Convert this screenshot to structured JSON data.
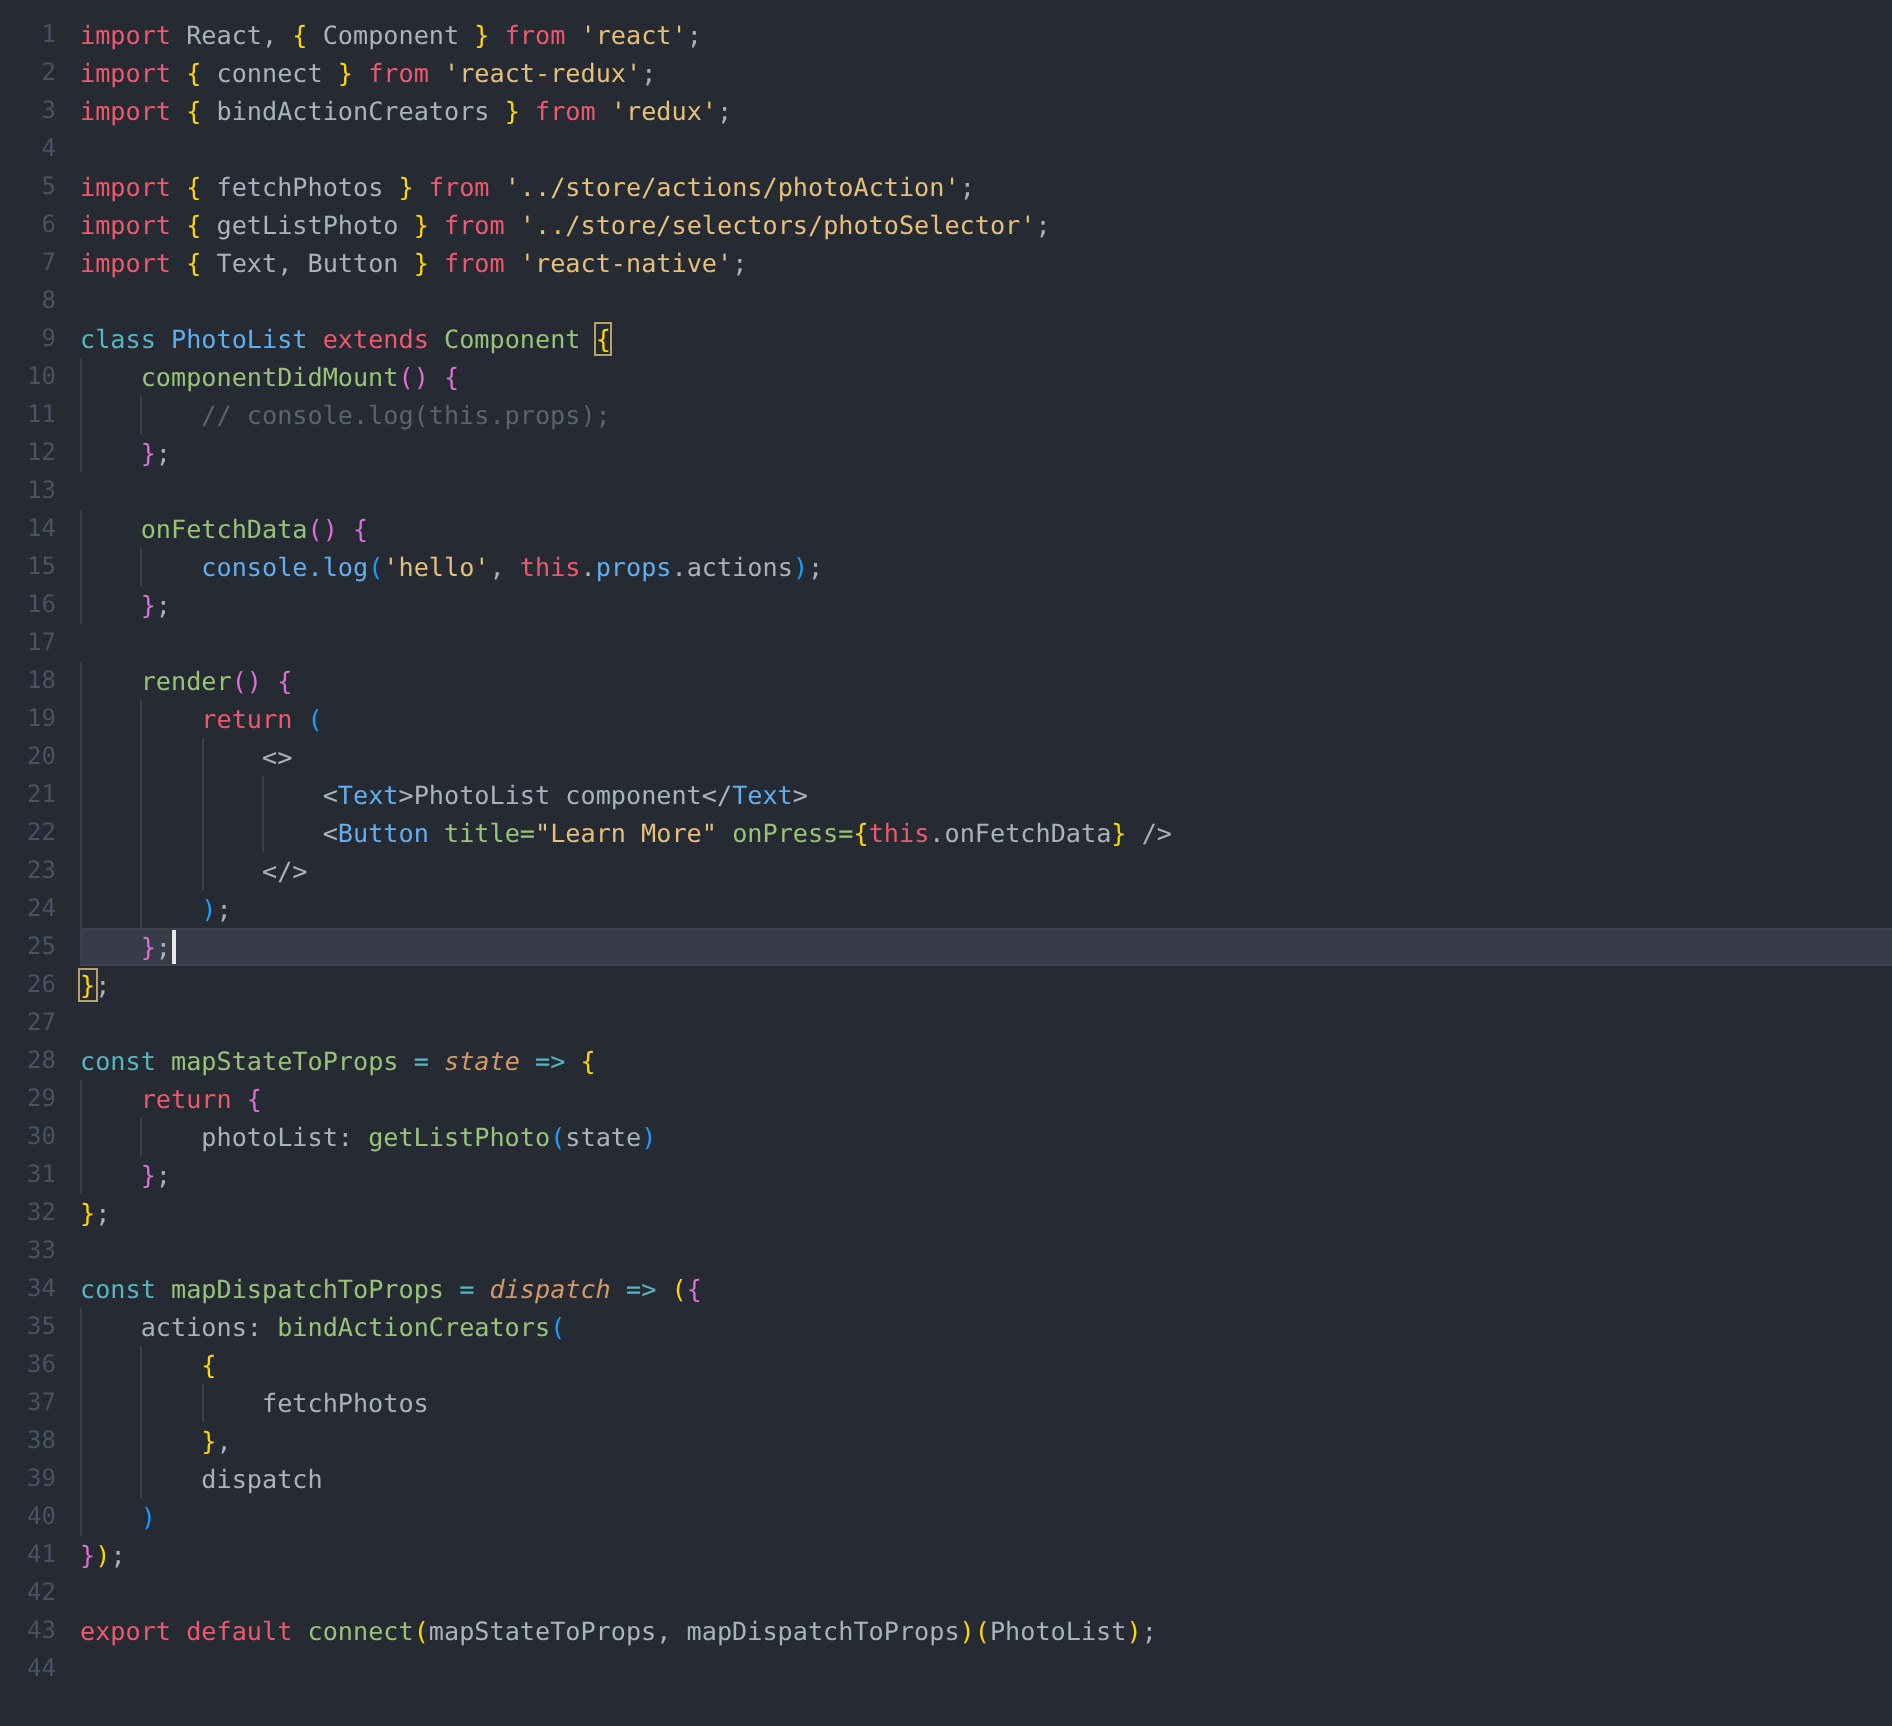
{
  "editor": {
    "lines": [
      {
        "number": "1",
        "current": false,
        "tokens": [
          {
            "text": "import",
            "kind": "kw"
          },
          {
            "text": " React, ",
            "kind": "plain"
          },
          {
            "text": "{",
            "kind": "b1"
          },
          {
            "text": " Component ",
            "kind": "plain"
          },
          {
            "text": "}",
            "kind": "b1"
          },
          {
            "text": " from ",
            "kind": "kw"
          },
          {
            "text": "'react'",
            "kind": "str"
          },
          {
            "text": ";",
            "kind": "plain"
          }
        ]
      },
      {
        "number": "2",
        "current": false,
        "tokens": [
          {
            "text": "import ",
            "kind": "kw"
          },
          {
            "text": "{",
            "kind": "b1"
          },
          {
            "text": " connect ",
            "kind": "plain"
          },
          {
            "text": "}",
            "kind": "b1"
          },
          {
            "text": " from ",
            "kind": "kw"
          },
          {
            "text": "'react-redux'",
            "kind": "str"
          },
          {
            "text": ";",
            "kind": "plain"
          }
        ]
      },
      {
        "number": "3",
        "current": false,
        "tokens": [
          {
            "text": "import ",
            "kind": "kw"
          },
          {
            "text": "{",
            "kind": "b1"
          },
          {
            "text": " bindActionCreators ",
            "kind": "plain"
          },
          {
            "text": "}",
            "kind": "b1"
          },
          {
            "text": " from ",
            "kind": "kw"
          },
          {
            "text": "'redux'",
            "kind": "str"
          },
          {
            "text": ";",
            "kind": "plain"
          }
        ]
      },
      {
        "number": "4",
        "current": false
      },
      {
        "number": "5",
        "current": false,
        "tokens": [
          {
            "text": "import ",
            "kind": "kw"
          },
          {
            "text": "{",
            "kind": "b1"
          },
          {
            "text": " fetchPhotos ",
            "kind": "plain"
          },
          {
            "text": "}",
            "kind": "b1"
          },
          {
            "text": " from ",
            "kind": "kw"
          },
          {
            "text": "'../store/actions/photoAction'",
            "kind": "str"
          },
          {
            "text": ";",
            "kind": "plain"
          }
        ]
      },
      {
        "number": "6",
        "current": false,
        "tokens": [
          {
            "text": "import ",
            "kind": "kw"
          },
          {
            "text": "{",
            "kind": "b1"
          },
          {
            "text": " getListPhoto ",
            "kind": "plain"
          },
          {
            "text": "}",
            "kind": "b1"
          },
          {
            "text": " from ",
            "kind": "kw"
          },
          {
            "text": "'../store/selectors/photoSelector'",
            "kind": "str"
          },
          {
            "text": ";",
            "kind": "plain"
          }
        ]
      },
      {
        "number": "7",
        "current": false,
        "tokens": [
          {
            "text": "import ",
            "kind": "kw"
          },
          {
            "text": "{",
            "kind": "b1"
          },
          {
            "text": " Text, Button ",
            "kind": "plain"
          },
          {
            "text": "}",
            "kind": "b1"
          },
          {
            "text": " from ",
            "kind": "kw"
          },
          {
            "text": "'react-native'",
            "kind": "str"
          },
          {
            "text": ";",
            "kind": "plain"
          }
        ]
      },
      {
        "number": "8",
        "current": false
      },
      {
        "number": "9",
        "current": false,
        "tokens": [
          {
            "text": "class ",
            "kind": "storage"
          },
          {
            "text": "PhotoList",
            "kind": "cls"
          },
          {
            "text": " extends ",
            "kind": "kw"
          },
          {
            "text": "Component ",
            "kind": "fn"
          },
          {
            "text": "{",
            "kind": "match"
          }
        ]
      },
      {
        "number": "10",
        "current": false,
        "tokens": [
          {
            "text": "    componentDidMount",
            "kind": "fn"
          },
          {
            "text": "() {",
            "kind": "b2"
          }
        ]
      },
      {
        "number": "11",
        "current": false,
        "tokens": [
          {
            "text": "        // console.log(this.props);",
            "kind": "comment"
          }
        ]
      },
      {
        "number": "12",
        "current": false,
        "tokens": [
          {
            "text": "    }",
            "kind": "b2"
          },
          {
            "text": ";",
            "kind": "plain"
          }
        ]
      },
      {
        "number": "13",
        "current": false
      },
      {
        "number": "14",
        "current": false,
        "tokens": [
          {
            "text": "    onFetchData",
            "kind": "fn"
          },
          {
            "text": "() {",
            "kind": "b2"
          }
        ]
      },
      {
        "number": "15",
        "current": false,
        "tokens": [
          {
            "text": "        console.log",
            "kind": "prop"
          },
          {
            "text": "(",
            "kind": "b3"
          },
          {
            "text": "'hello'",
            "kind": "str"
          },
          {
            "text": ", ",
            "kind": "plain"
          },
          {
            "text": "this",
            "kind": "kw"
          },
          {
            "text": ".",
            "kind": "plain"
          },
          {
            "text": "props",
            "kind": "prop"
          },
          {
            "text": ".actions",
            "kind": "plain"
          },
          {
            "text": ")",
            "kind": "b3"
          },
          {
            "text": ";",
            "kind": "plain"
          }
        ]
      },
      {
        "number": "16",
        "current": false,
        "tokens": [
          {
            "text": "    }",
            "kind": "b2"
          },
          {
            "text": ";",
            "kind": "plain"
          }
        ]
      },
      {
        "number": "17",
        "current": false
      },
      {
        "number": "18",
        "current": false,
        "tokens": [
          {
            "text": "    render",
            "kind": "fn"
          },
          {
            "text": "() {",
            "kind": "b2"
          }
        ]
      },
      {
        "number": "19",
        "current": false,
        "tokens": [
          {
            "text": "        return ",
            "kind": "kw"
          },
          {
            "text": "(",
            "kind": "b3"
          }
        ]
      },
      {
        "number": "20",
        "current": false,
        "tokens": [
          {
            "text": "            <>",
            "kind": "plain"
          }
        ]
      },
      {
        "number": "21",
        "current": false,
        "tokens": [
          {
            "text": "                <",
            "kind": "plain"
          },
          {
            "text": "Text",
            "kind": "prop"
          },
          {
            "text": ">PhotoList component</",
            "kind": "plain"
          },
          {
            "text": "Text",
            "kind": "prop"
          },
          {
            "text": ">",
            "kind": "plain"
          }
        ]
      },
      {
        "number": "22",
        "current": false,
        "tokens": [
          {
            "text": "                <",
            "kind": "plain"
          },
          {
            "text": "Button",
            "kind": "prop"
          },
          {
            "text": " title=",
            "kind": "fn"
          },
          {
            "text": "\"Learn More\"",
            "kind": "str"
          },
          {
            "text": " onPress=",
            "kind": "fn"
          },
          {
            "text": "{",
            "kind": "b1"
          },
          {
            "text": "this",
            "kind": "kw"
          },
          {
            "text": ".onFetchData",
            "kind": "plain"
          },
          {
            "text": "}",
            "kind": "b1"
          },
          {
            "text": " />",
            "kind": "plain"
          }
        ]
      },
      {
        "number": "23",
        "current": false,
        "tokens": [
          {
            "text": "            </>",
            "kind": "plain"
          }
        ]
      },
      {
        "number": "24",
        "current": false,
        "tokens": [
          {
            "text": "        )",
            "kind": "b3"
          },
          {
            "text": ";",
            "kind": "plain"
          }
        ]
      },
      {
        "number": "25",
        "current": true,
        "tokens": [
          {
            "text": "    }",
            "kind": "b2"
          },
          {
            "text": ";",
            "kind": "plain"
          }
        ]
      },
      {
        "number": "26",
        "current": false,
        "tokens": [
          {
            "text": "}",
            "kind": "match"
          },
          {
            "text": ";",
            "kind": "plain"
          }
        ]
      },
      {
        "number": "27",
        "current": false
      },
      {
        "number": "28",
        "current": false,
        "tokens": [
          {
            "text": "const ",
            "kind": "storage"
          },
          {
            "text": "mapStateToProps",
            "kind": "fn"
          },
          {
            "text": " = ",
            "kind": "op"
          },
          {
            "text": "state",
            "kind": "param"
          },
          {
            "text": " => ",
            "kind": "op"
          },
          {
            "text": "{",
            "kind": "b1"
          }
        ]
      },
      {
        "number": "29",
        "current": false,
        "tokens": [
          {
            "text": "    return ",
            "kind": "kw"
          },
          {
            "text": "{",
            "kind": "b2"
          }
        ]
      },
      {
        "number": "30",
        "current": false,
        "tokens": [
          {
            "text": "        photoList: ",
            "kind": "plain"
          },
          {
            "text": "getListPhoto",
            "kind": "fn"
          },
          {
            "text": "(",
            "kind": "b3"
          },
          {
            "text": "state",
            "kind": "plain"
          },
          {
            "text": ")",
            "kind": "b3"
          }
        ]
      },
      {
        "number": "31",
        "current": false,
        "tokens": [
          {
            "text": "    }",
            "kind": "b2"
          },
          {
            "text": ";",
            "kind": "plain"
          }
        ]
      },
      {
        "number": "32",
        "current": false,
        "tokens": [
          {
            "text": "}",
            "kind": "b1"
          },
          {
            "text": ";",
            "kind": "plain"
          }
        ]
      },
      {
        "number": "33",
        "current": false
      },
      {
        "number": "34",
        "current": false,
        "tokens": [
          {
            "text": "const ",
            "kind": "storage"
          },
          {
            "text": "mapDispatchToProps",
            "kind": "fn"
          },
          {
            "text": " = ",
            "kind": "op"
          },
          {
            "text": "dispatch",
            "kind": "param"
          },
          {
            "text": " => ",
            "kind": "op"
          },
          {
            "text": "(",
            "kind": "b1"
          },
          {
            "text": "{",
            "kind": "b2"
          }
        ]
      },
      {
        "number": "35",
        "current": false,
        "tokens": [
          {
            "text": "    actions: ",
            "kind": "plain"
          },
          {
            "text": "bindActionCreators",
            "kind": "fn"
          },
          {
            "text": "(",
            "kind": "b3"
          }
        ]
      },
      {
        "number": "36",
        "current": false,
        "tokens": [
          {
            "text": "        {",
            "kind": "b1"
          }
        ]
      },
      {
        "number": "37",
        "current": false,
        "tokens": [
          {
            "text": "            fetchPhotos",
            "kind": "plain"
          }
        ]
      },
      {
        "number": "38",
        "current": false,
        "tokens": [
          {
            "text": "        }",
            "kind": "b1"
          },
          {
            "text": ",",
            "kind": "plain"
          }
        ]
      },
      {
        "number": "39",
        "current": false,
        "tokens": [
          {
            "text": "        dispatch",
            "kind": "plain"
          }
        ]
      },
      {
        "number": "40",
        "current": false,
        "tokens": [
          {
            "text": "    )",
            "kind": "b3"
          }
        ]
      },
      {
        "number": "41",
        "current": false,
        "tokens": [
          {
            "text": "}",
            "kind": "b2"
          },
          {
            "text": ")",
            "kind": "b1"
          },
          {
            "text": ";",
            "kind": "plain"
          }
        ]
      },
      {
        "number": "42",
        "current": false
      },
      {
        "number": "43",
        "current": false,
        "tokens": [
          {
            "text": "export default ",
            "kind": "kw"
          },
          {
            "text": "connect",
            "kind": "fn"
          },
          {
            "text": "(",
            "kind": "b1"
          },
          {
            "text": "mapStateToProps, mapDispatchToProps",
            "kind": "plain"
          },
          {
            "text": ")",
            "kind": "b1"
          },
          {
            "text": "(",
            "kind": "b1"
          },
          {
            "text": "PhotoList",
            "kind": "plain"
          },
          {
            "text": ")",
            "kind": "b1"
          },
          {
            "text": ";",
            "kind": "plain"
          }
        ]
      },
      {
        "number": "44",
        "current": false
      }
    ]
  }
}
